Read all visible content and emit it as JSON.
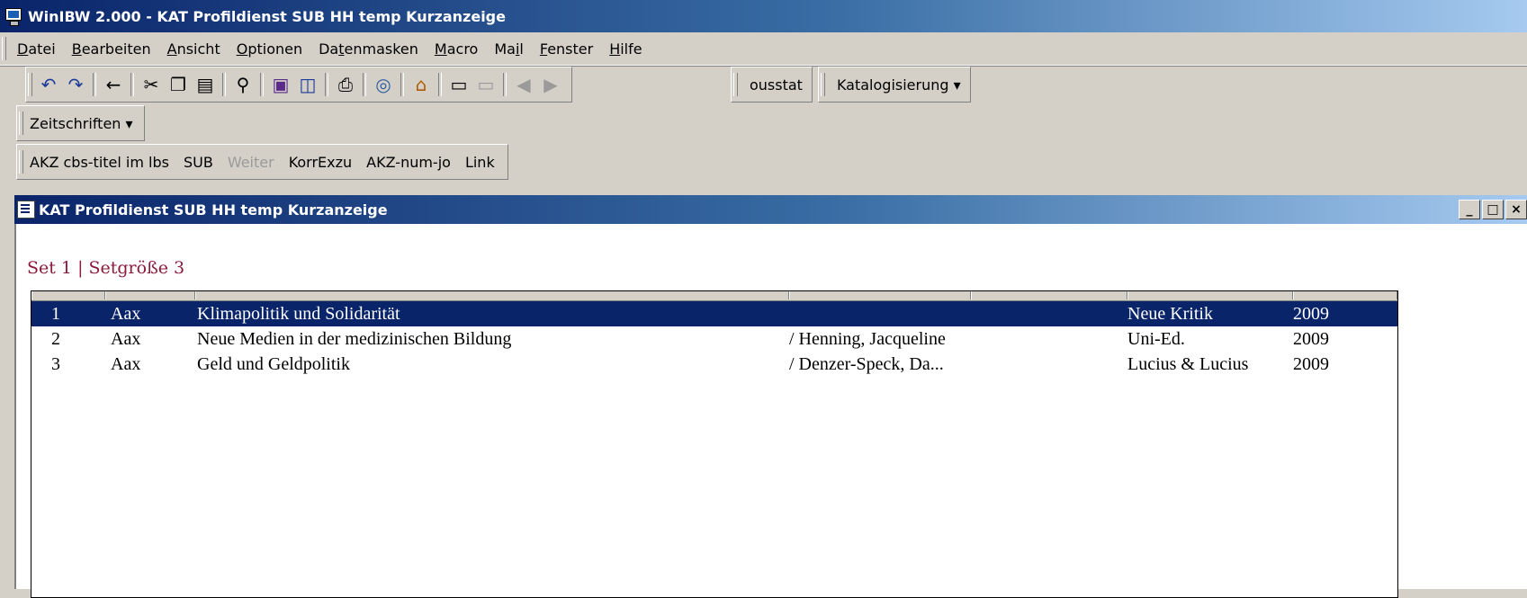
{
  "window": {
    "title": "WinIBW 2.000 - KAT Profildienst SUB HH temp Kurzanzeige"
  },
  "menu": [
    {
      "pre": "",
      "key": "D",
      "post": "atei"
    },
    {
      "pre": "",
      "key": "B",
      "post": "earbeiten"
    },
    {
      "pre": "",
      "key": "A",
      "post": "nsicht"
    },
    {
      "pre": "",
      "key": "O",
      "post": "ptionen"
    },
    {
      "pre": "Da",
      "key": "t",
      "post": "enmasken"
    },
    {
      "pre": "",
      "key": "M",
      "post": "acro"
    },
    {
      "pre": "Ma",
      "key": "i",
      "post": "l"
    },
    {
      "pre": "",
      "key": "F",
      "post": "enster"
    },
    {
      "pre": "",
      "key": "H",
      "post": "ilfe"
    }
  ],
  "toolbar": {
    "icons": [
      "undo-icon",
      "redo-icon",
      "back-arrow-icon",
      "cut-icon",
      "copy-icon",
      "paste-icon",
      "binoculars-icon",
      "book-icon",
      "split-view-icon",
      "printer-icon",
      "globe-search-icon",
      "home-icon",
      "form-icon",
      "form-disabled-icon",
      "arrow-left-icon",
      "arrow-right-icon"
    ],
    "ousstat": "ousstat",
    "katalogisierung": "Katalogisierung ▾"
  },
  "toolbar2": {
    "zeitschriften": "Zeitschriften ▾"
  },
  "toolbar3": {
    "buttons": [
      "AKZ cbs-titel im lbs",
      "SUB",
      "Weiter",
      "KorrExzu",
      "AKZ-num-jo",
      "Link"
    ]
  },
  "child": {
    "title": "KAT Profildienst SUB HH temp Kurzanzeige"
  },
  "set": {
    "label": "Set 1 |  Setgröße 3"
  },
  "rows": [
    {
      "num": "1",
      "code": "Aax",
      "title": "Klimapolitik und Solidarität",
      "author": "",
      "publisher": "Neue Kritik",
      "year": "2009"
    },
    {
      "num": "2",
      "code": "Aax",
      "title": "Neue Medien in der medizinischen Bildung",
      "author": "/ Henning, Jacqueline",
      "publisher": "Uni-Ed.",
      "year": "2009"
    },
    {
      "num": "3",
      "code": "Aax",
      "title": "Geld und Geldpolitik",
      "author": "/ Denzer-Speck, Da...",
      "publisher": "Lucius & Lucius",
      "year": "2009"
    }
  ],
  "colors": {
    "selection": "#0a246a",
    "set_text": "#8b1a3c"
  }
}
